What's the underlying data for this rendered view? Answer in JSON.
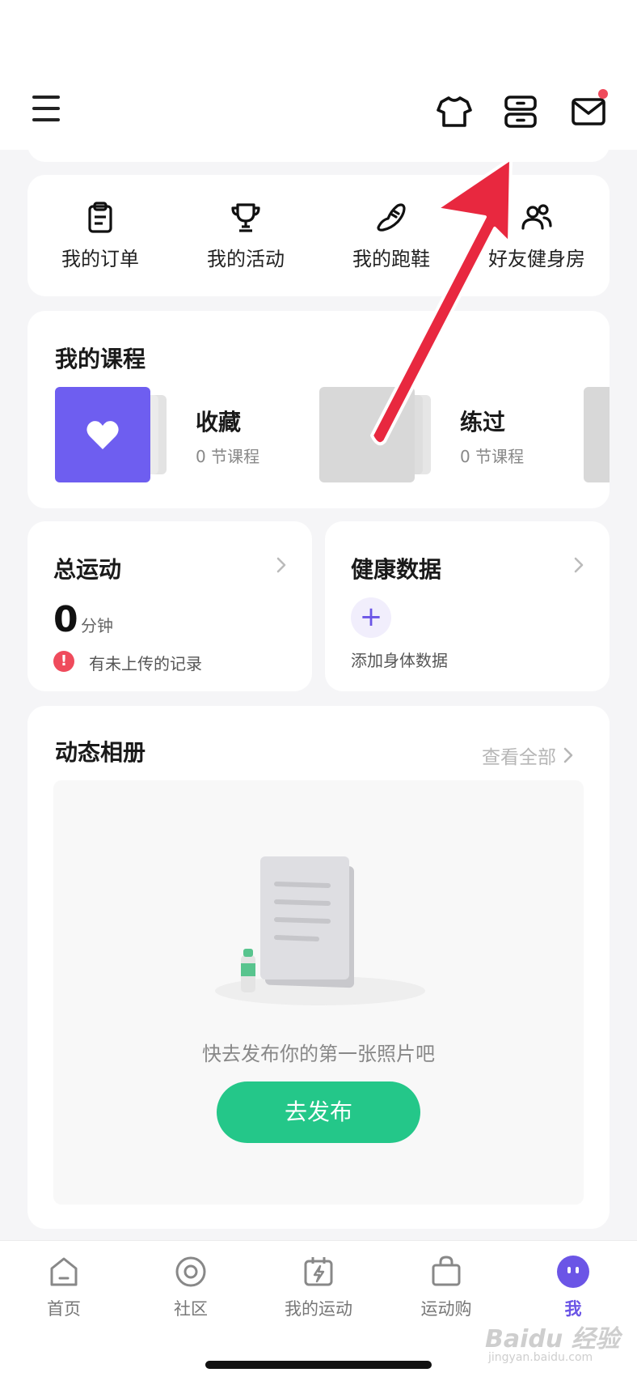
{
  "colors": {
    "accent": "#6b55e6",
    "green": "#24c789",
    "alert": "#ef4b5c",
    "annotation_arrow": "#e8283f"
  },
  "header": {
    "menu_icon": "hamburger-menu-icon",
    "icons": [
      "shirt-icon",
      "server-icon",
      "mail-icon"
    ],
    "mail_has_badge": true
  },
  "shortcuts": [
    {
      "label": "我的订单",
      "icon": "clipboard-icon"
    },
    {
      "label": "我的活动",
      "icon": "trophy-icon"
    },
    {
      "label": "我的跑鞋",
      "icon": "shoe-icon"
    },
    {
      "label": "好友健身房",
      "icon": "friends-icon"
    }
  ],
  "courses": {
    "title": "我的课程",
    "items": [
      {
        "name": "收藏",
        "count": "0 节课程",
        "icon": "heart-icon"
      },
      {
        "name": "练过",
        "count": "0 节课程"
      }
    ]
  },
  "total_exercise": {
    "title": "总运动",
    "value": "0",
    "unit": "分钟",
    "warning": "有未上传的记录"
  },
  "health": {
    "title": "健康数据",
    "add_label": "添加身体数据"
  },
  "album": {
    "title": "动态相册",
    "view_all": "查看全部",
    "empty_text": "快去发布你的第一张照片吧",
    "publish_label": "去发布"
  },
  "tabbar": [
    {
      "label": "首页",
      "icon": "home-icon",
      "active": false
    },
    {
      "label": "社区",
      "icon": "community-icon",
      "active": false
    },
    {
      "label": "我的运动",
      "icon": "calendar-bolt-icon",
      "active": false
    },
    {
      "label": "运动购",
      "icon": "shopping-bag-icon",
      "active": false
    },
    {
      "label": "我",
      "icon": "profile-face-icon",
      "active": true
    }
  ],
  "watermark": {
    "text": "Baidu 经验",
    "sub": "jingyan.baidu.com"
  }
}
